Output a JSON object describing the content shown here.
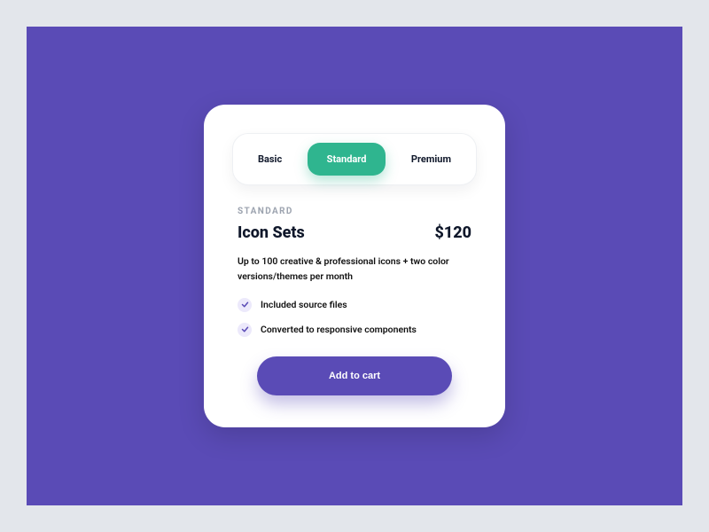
{
  "colors": {
    "page_bg": "#E3E6EB",
    "stage_bg": "#5A4BB6",
    "accent_green": "#2FB58F",
    "primary_purple": "#5A4BB6"
  },
  "tabs": [
    {
      "label": "Basic",
      "active": false
    },
    {
      "label": "Standard",
      "active": true
    },
    {
      "label": "Premium",
      "active": false
    }
  ],
  "plan": {
    "eyebrow": "STANDARD",
    "title": "Icon Sets",
    "price": "$120",
    "description": "Up to 100 creative & professional  icons + two color versions/themes per month",
    "features": [
      "Included  source files",
      "Converted to responsive components"
    ],
    "cta_label": "Add to cart"
  }
}
